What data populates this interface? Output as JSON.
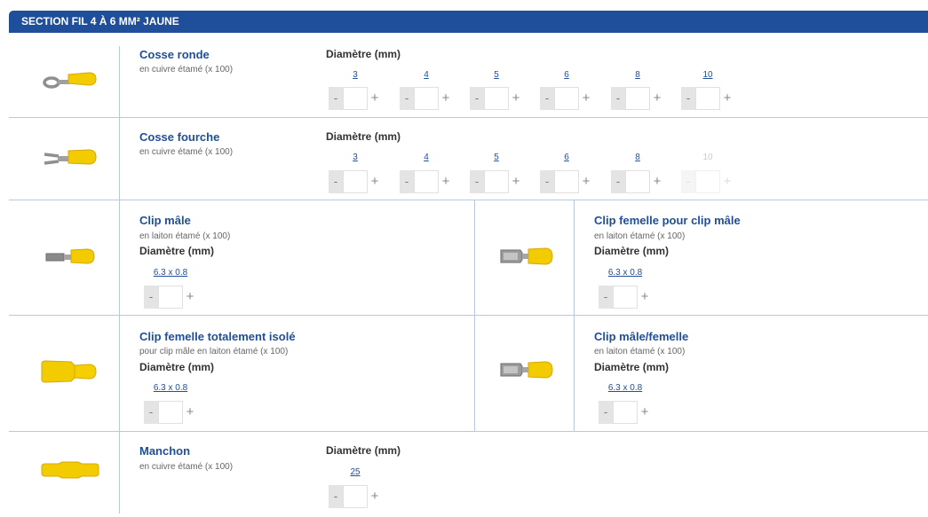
{
  "section": {
    "title": "SECTION FIL 4 À 6 MM² JAUNE"
  },
  "products": {
    "cosse_ronde": {
      "title": "Cosse ronde",
      "subtitle": "en cuivre étamé (x 100)",
      "diam_label": "Diamètre (mm)",
      "sizes": [
        "3",
        "4",
        "5",
        "6",
        "8",
        "10"
      ]
    },
    "cosse_fourche": {
      "title": "Cosse fourche",
      "subtitle": "en cuivre étamé (x 100)",
      "diam_label": "Diamètre (mm)",
      "sizes": [
        "3",
        "4",
        "5",
        "6",
        "8",
        "10"
      ],
      "disabled_sizes": [
        "10"
      ]
    },
    "clip_male": {
      "title": "Clip mâle",
      "subtitle": "en laiton étamé (x 100)",
      "diam_label": "Diamètre (mm)",
      "sizes": [
        "6.3 x 0.8"
      ]
    },
    "clip_femelle_pour_clip_male": {
      "title": "Clip femelle pour clip mâle",
      "subtitle": "en laiton étamé (x 100)",
      "diam_label": "Diamètre (mm)",
      "sizes": [
        "6.3 x 0.8"
      ]
    },
    "clip_femelle_isole": {
      "title": "Clip femelle totalement isolé",
      "subtitle": "pour clip mâle en laiton étamé (x 100)",
      "diam_label": "Diamètre (mm)",
      "sizes": [
        "6.3 x 0.8"
      ]
    },
    "clip_male_femelle": {
      "title": "Clip mâle/femelle",
      "subtitle": "en laiton étamé (x 100)",
      "diam_label": "Diamètre (mm)",
      "sizes": [
        "6.3 x 0.8"
      ]
    },
    "manchon": {
      "title": "Manchon",
      "subtitle": "en cuivre étamé (x 100)",
      "diam_label": "Diamètre (mm)",
      "sizes": [
        "25"
      ]
    }
  },
  "stepper": {
    "minus": "-",
    "plus": "+"
  },
  "colors": {
    "header": "#1f4e9a",
    "title": "#1f4e9a",
    "insulation": "#f2cc00",
    "metal": "#9a9a9a"
  }
}
